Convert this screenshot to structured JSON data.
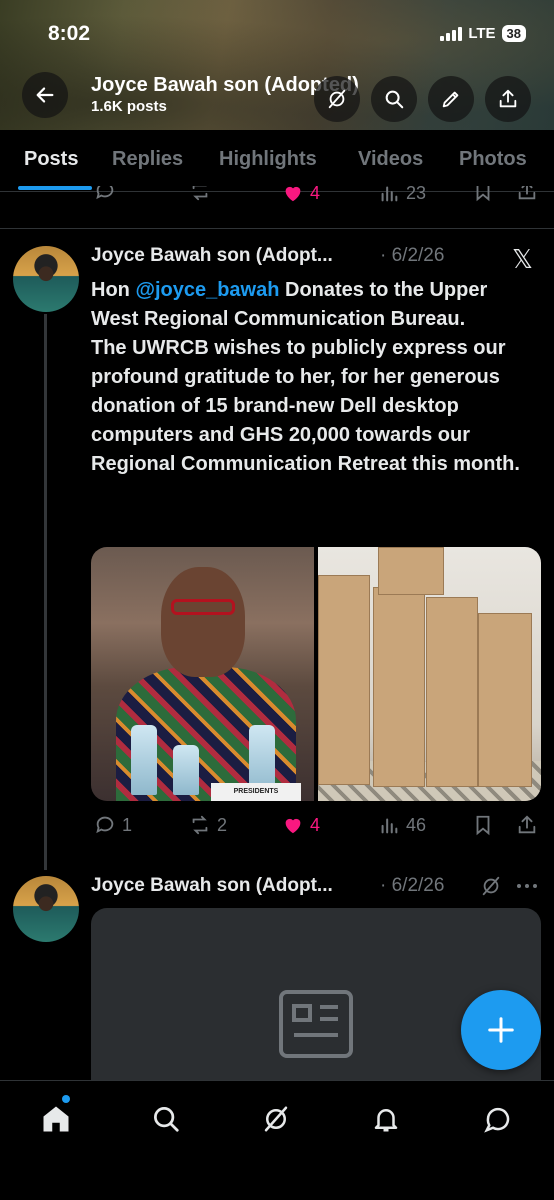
{
  "status_bar": {
    "time": "8:02",
    "network": "LTE",
    "battery": "38"
  },
  "header": {
    "title": "Joyce Bawah son (Adopted)",
    "post_count": "1.6K posts"
  },
  "tabs": [
    {
      "label": "Posts",
      "active": true
    },
    {
      "label": "Replies",
      "active": false
    },
    {
      "label": "Highlights",
      "active": false
    },
    {
      "label": "Videos",
      "active": false
    },
    {
      "label": "Photos",
      "active": false
    }
  ],
  "prev_post_actions": {
    "likes": "4",
    "views": "23"
  },
  "post": {
    "author": "Joyce Bawah son (Adopt...",
    "date": "· 6/2/26",
    "text_prefix": "Hon ",
    "mention": "@joyce_bawah",
    "text_line1_rest": " Donates to the Upper West Regional Communication Bureau.",
    "text_body": "The UWRCB  wishes to publicly express our profound gratitude to her, for her generous donation of 15 brand-new Dell desktop computers and GHS 20,000 towards our Regional Communication Retreat this month.",
    "placard_text": "PRESIDENTS",
    "replies": "1",
    "reposts": "2",
    "likes": "4",
    "views": "46"
  },
  "post2": {
    "author": "Joyce Bawah son (Adopt...",
    "date": "· 6/2/26"
  },
  "colors": {
    "accent": "#1d9bf0",
    "like": "#f91880",
    "muted": "#71767b"
  }
}
